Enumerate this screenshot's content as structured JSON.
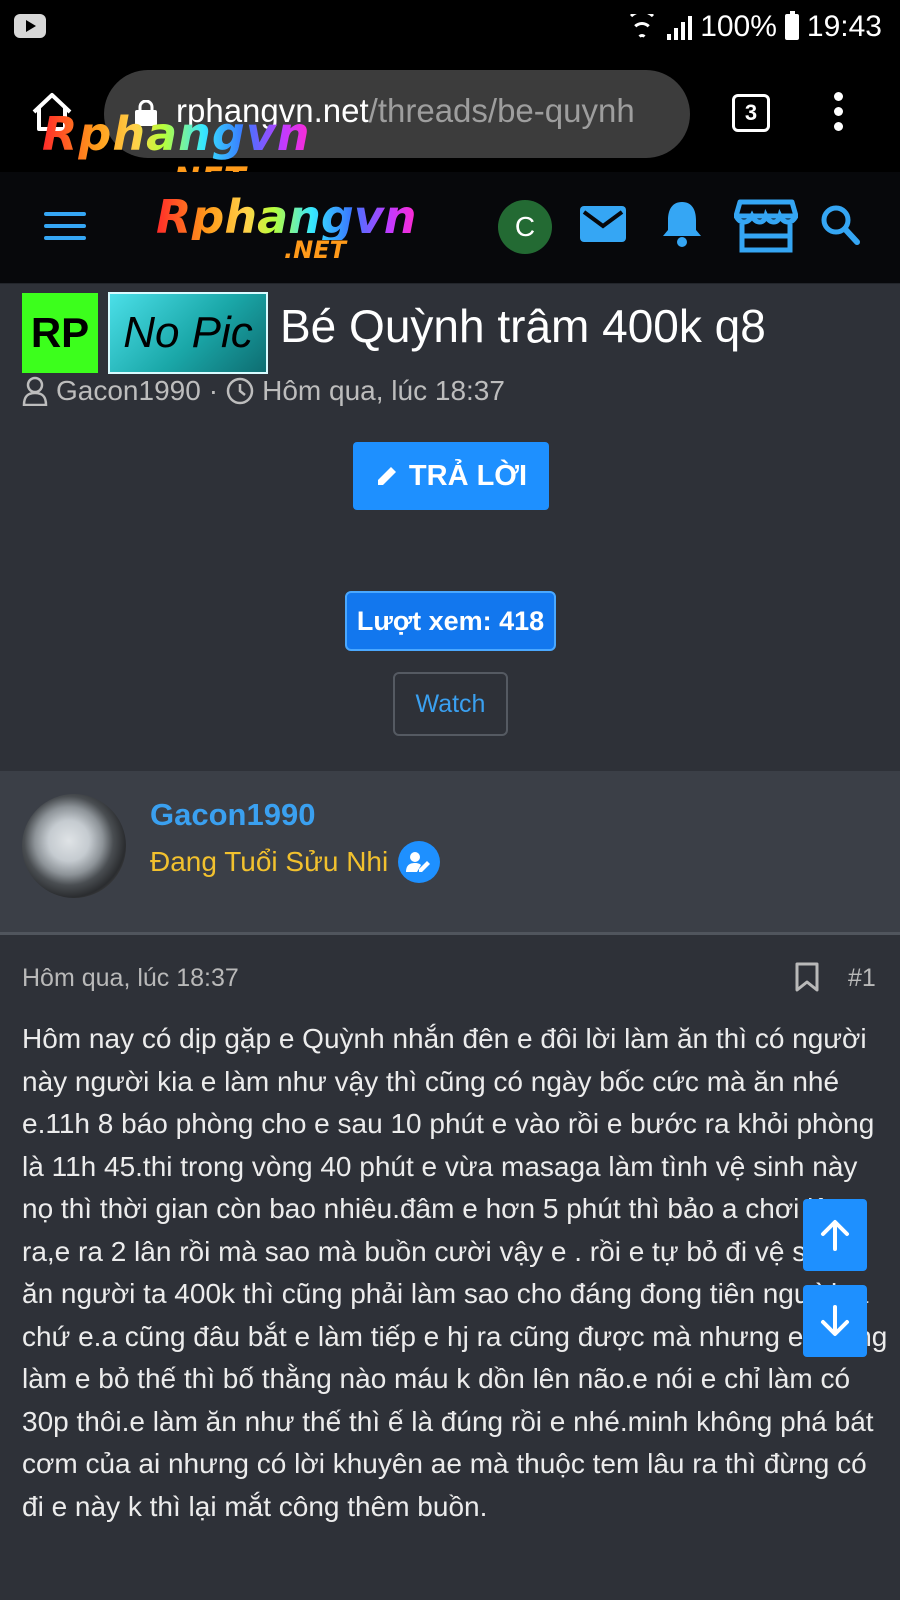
{
  "status_bar": {
    "battery": "100%",
    "time": "19:43"
  },
  "browser": {
    "url_host": "rphangvn.net",
    "url_path": "/threads/be-quynh",
    "tab_count": "3",
    "overlay_logo": "Rphangvn",
    "overlay_logo_suffix": ".NET"
  },
  "site_header": {
    "logo": "Rphangvn",
    "logo_suffix": ".NET",
    "account_initial": "C",
    "accent_color": "#35a6f4"
  },
  "thread": {
    "prefix_rp": "RP",
    "prefix_nopic": "No Pic",
    "title": "Bé Quỳnh trâm 400k q8",
    "author": "Gacon1990",
    "separator": "·",
    "date": "Hôm qua, lúc 18:37",
    "reply_label": "TRẢ LỜI",
    "views_label": "Lượt xem: 418",
    "watch_label": "Watch"
  },
  "post": {
    "username": "Gacon1990",
    "user_title": "Đang Tuổi Sửu Nhi",
    "date": "Hôm qua, lúc 18:37",
    "number": "#1",
    "text": "Hôm nay có dịp gặp e Quỳnh nhắn đên e đôi lời làm ăn thì có người này người kia e làm như vậy thì cũng có ngày bốc cức mà ăn nhé e.11h 8 báo phòng cho e sau 10 phút e vào rồi e bước ra khỏi phòng là 11h 45.thi trong vòng 40 phút e vừa masaga làm tình vệ sinh này nọ thì thời gian còn bao nhiêu.đâm e hơn 5 phút thì bảo a chơi lâu ra,e ra 2 lân rồi mà sao mà buồn cười vậy e . rồi e tự bỏ đi vệ sinh e ăn người ta 400k thì cũng phải làm sao cho đáng đong tiên người ta chứ e.a cũng đâu bắt e làm tiếp e hj ra cũng được mà nhưng e không làm e bỏ thế thì bố thằng nào máu k dồn lên não.e nói e chỉ làm có 30p thôi.e làm ăn như thế thì ế là đúng rồi e nhé.minh không phá bát cơm của ai nhưng có lời khuyên ae mà thuộc tem lâu ra thì đừng có đi e này k thì lại mắt công thêm buồn."
  },
  "icons": {
    "home": "home-icon",
    "lock": "lock-icon",
    "menu": "hamburger-icon",
    "mail": "mail-icon",
    "bell": "bell-icon",
    "store": "store-icon",
    "search": "search-icon",
    "user": "user-icon",
    "clock": "clock-icon",
    "pencil": "pencil-icon",
    "bookmark": "bookmark-icon",
    "arrow_up": "arrow-up-icon",
    "arrow_down": "arrow-down-icon"
  }
}
